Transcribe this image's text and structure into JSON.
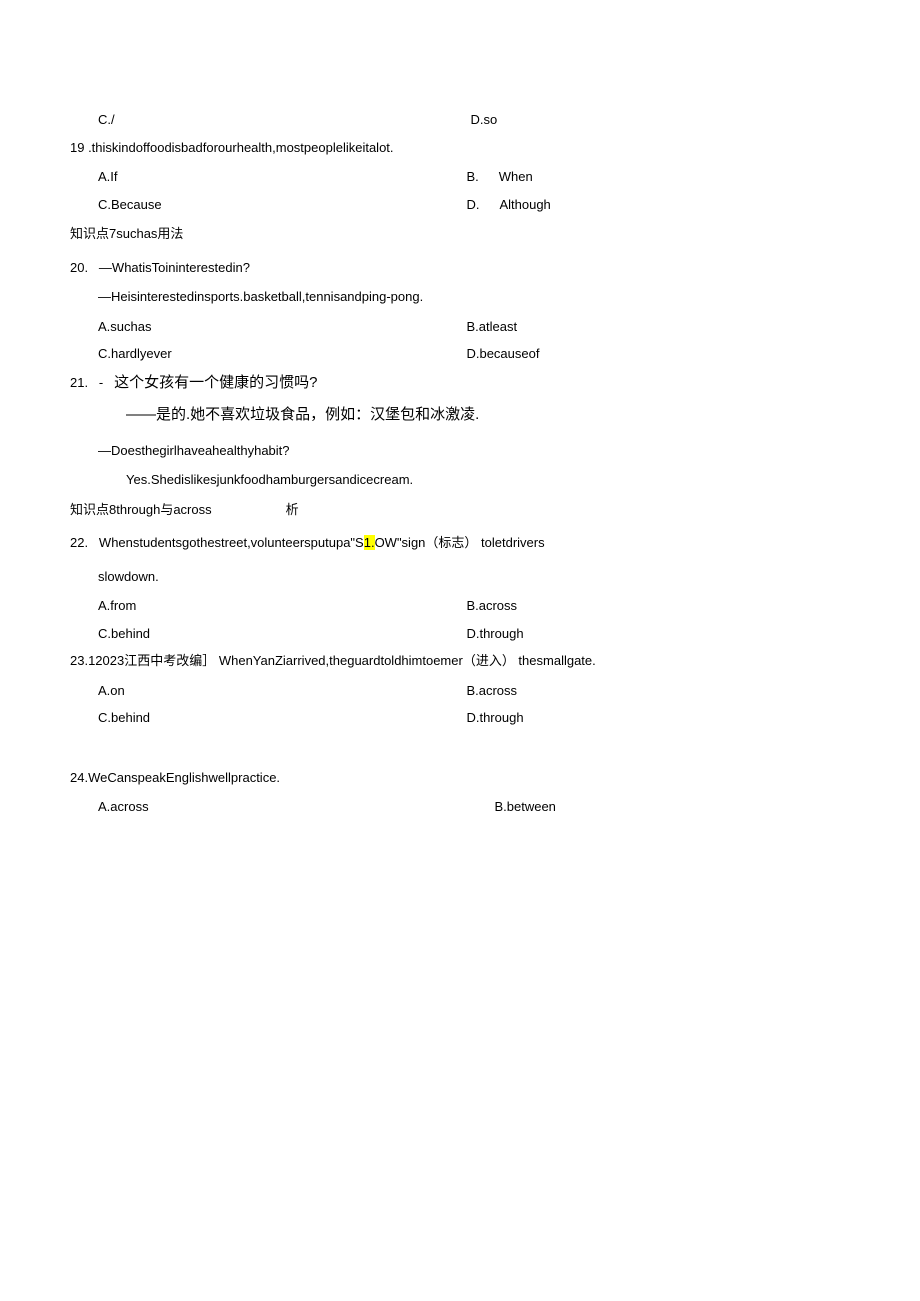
{
  "q18": {
    "optC": "C./",
    "optD": "D.so"
  },
  "q19": {
    "line": "19   .thiskindoffoodisbadforourhealth,mostpeoplelikeitalot.",
    "optA": "A.If",
    "optB_prefix": "B.",
    "optB_val": "When",
    "optC": "C.Because",
    "optD_prefix": "D.",
    "optD_val": "Although"
  },
  "sec7": "知识点7suchas用法",
  "q20": {
    "line1_num": "20.",
    "line1_txt": "—WhatisToininterestedin?",
    "line2": "—Heisinterestedinsports.basketball,tennisandping-pong.",
    "optA": "A.suchas",
    "optB": "B.atleast",
    "optC": "C.hardlyever",
    "optD": "D.becauseof"
  },
  "q21": {
    "line1_num": "21.",
    "line1_dash": "-",
    "line1_cn": "这个女孩有一个健康的习惯吗?",
    "line2": "——是的.她不喜欢垃圾食品，例如：汉堡包和冰激凌.",
    "line3": "—Doesthegirlhaveahealthyhabit?",
    "line4": "Yes.Shedislikesjunkfoodhamburgersandicecream."
  },
  "sec8_pre": "知识点8through与across",
  "sec8_suf": "析",
  "q22": {
    "line1_num": "22.",
    "line1_a": "Whenstudentsgothestreet,volunteersputupa\"S",
    "line1_hl": "1.",
    "line1_b": "OW\"sign（标志） toletdrivers",
    "line2": "slowdown.",
    "optA": "A.from",
    "optB": "B.across",
    "optC": "C.behind",
    "optD": "D.through"
  },
  "q23": {
    "line": "23.12023江西中考改编］ WhenYanZiarrived,theguardtoldhimtoemer（进入） thesmallgate.",
    "optA": "A.on",
    "optB": "B.across",
    "optC": "C.behind",
    "optD": "D.through"
  },
  "q24": {
    "line": "24.WeCanspeakEnglishwellpractice.",
    "optA": "A.across",
    "optB": "B.between"
  }
}
